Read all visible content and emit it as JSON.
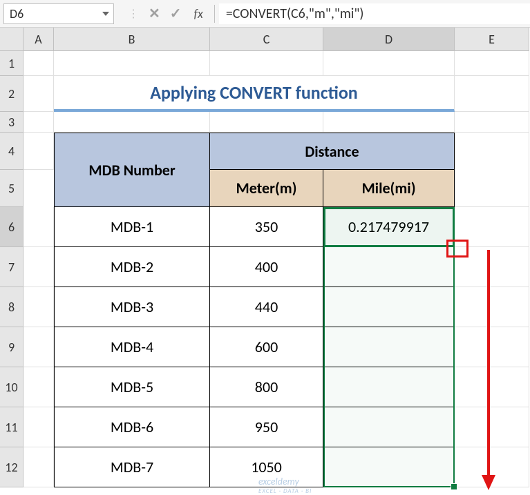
{
  "formula_bar": {
    "cell_ref": "D6",
    "fx_label": "fx",
    "formula": "=CONVERT(C6,\"m\",\"mi\")"
  },
  "columns": [
    "A",
    "B",
    "C",
    "D",
    "E"
  ],
  "rows": [
    "1",
    "2",
    "3",
    "4",
    "5",
    "6",
    "7",
    "8",
    "9",
    "10",
    "11",
    "12"
  ],
  "title": "Applying CONVERT function",
  "headers": {
    "mdb": "MDB Number",
    "distance": "Distance",
    "meter": "Meter(m)",
    "mile": "Mile(mi)"
  },
  "data": [
    {
      "mdb": "MDB-1",
      "meter": "350",
      "mile": "0.217479917"
    },
    {
      "mdb": "MDB-2",
      "meter": "400",
      "mile": ""
    },
    {
      "mdb": "MDB-3",
      "meter": "440",
      "mile": ""
    },
    {
      "mdb": "MDB-4",
      "meter": "600",
      "mile": ""
    },
    {
      "mdb": "MDB-5",
      "meter": "800",
      "mile": ""
    },
    {
      "mdb": "MDB-6",
      "meter": "950",
      "mile": ""
    },
    {
      "mdb": "MDB-7",
      "meter": "1050",
      "mile": ""
    }
  ],
  "watermark": {
    "brand": "exceldemy",
    "tag": "EXCEL · DATA · BI"
  },
  "chart_data": {
    "type": "table",
    "title": "Applying CONVERT function",
    "columns": [
      "MDB Number",
      "Meter(m)",
      "Mile(mi)"
    ],
    "rows": [
      [
        "MDB-1",
        350,
        0.217479917
      ],
      [
        "MDB-2",
        400,
        null
      ],
      [
        "MDB-3",
        440,
        null
      ],
      [
        "MDB-4",
        600,
        null
      ],
      [
        "MDB-5",
        800,
        null
      ],
      [
        "MDB-6",
        950,
        null
      ],
      [
        "MDB-7",
        1050,
        null
      ]
    ],
    "formula": "=CONVERT(C6,\"m\",\"mi\")",
    "active_cell": "D6"
  }
}
